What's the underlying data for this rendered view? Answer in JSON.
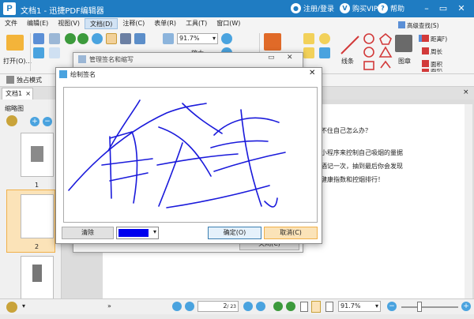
{
  "titlebar": {
    "logo": "P",
    "title": "文档1 - 迅捷PDF编辑器",
    "login": "注册/登录",
    "vip": "购买VIP",
    "help": "帮助"
  },
  "menu": [
    "文件",
    "编辑(E)",
    "视图(V)",
    "文档(D)",
    "注释(C)",
    "表单(R)",
    "工具(T)",
    "窗口(W)"
  ],
  "menu_active_index": 3,
  "ribbon": {
    "open_label": "打开(O)...",
    "zoom_value": "91.7%",
    "line_label": "线条",
    "image_label": "图章",
    "find_label": "查找(F)",
    "adv_find_label": "高级查找(S)",
    "distance_label": "距离",
    "perimeter_label": "周长",
    "area_label": "面积",
    "enlarge_label": "放大"
  },
  "modebar": {
    "mode_label": "独占模式"
  },
  "tab": {
    "doc_tab": "文档1"
  },
  "thumbs": {
    "title": "缩略图",
    "pages": [
      "1",
      "2",
      "3"
    ]
  },
  "doc_text": [
    "不住自己怎么办？",
    "小程序来控制自己吸烟的量据",
    "酒记一次，抽到最后你会发现",
    "健康指数和控烟排行！"
  ],
  "statusbar": {
    "page_current": "2",
    "page_total": "/ 23",
    "zoom": "91.7%"
  },
  "bgdialog": {
    "title": "管理签名和缩写",
    "close_button": "关闭(C)"
  },
  "drawdialog": {
    "title": "绘制签名",
    "clear_button": "清除",
    "ok_button": "确定(O)",
    "cancel_button": "取消(C)",
    "pen_color": "#0000ee",
    "signature_text": "有钱"
  },
  "colors": {
    "titlebar": "#1f7cc2",
    "ink": "#1a1adb",
    "accent": "#f7c36b"
  }
}
